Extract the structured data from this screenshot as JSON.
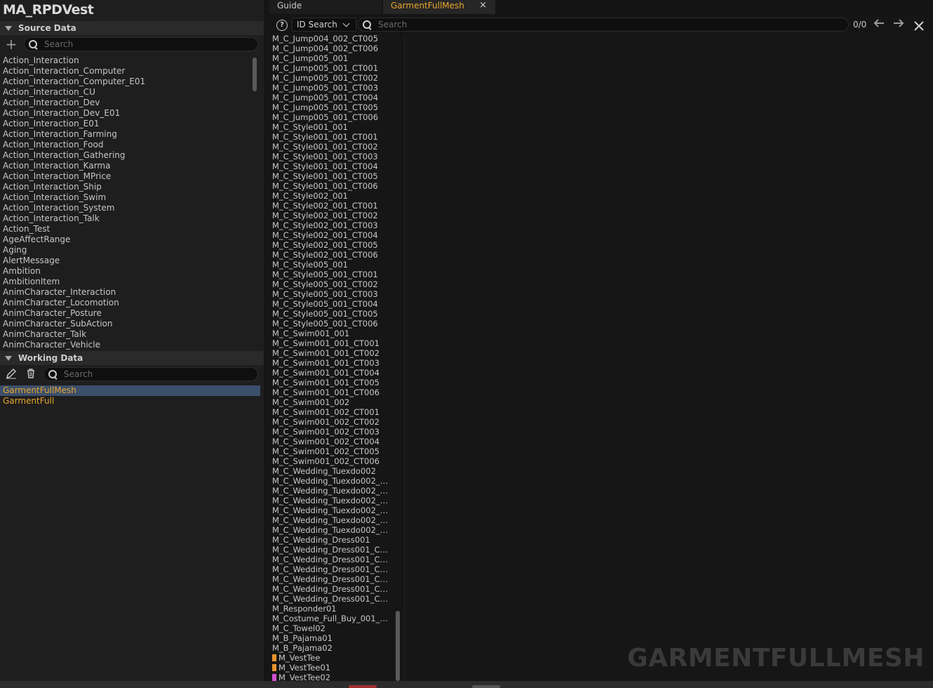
{
  "asset_title": "MA_RPDVest",
  "source": {
    "header": "Source Data",
    "search_placeholder": "Search",
    "items": [
      "Action_Interaction",
      "Action_Interaction_Computer",
      "Action_Interaction_Computer_E01",
      "Action_Interaction_CU",
      "Action_Interaction_Dev",
      "Action_Interaction_Dev_E01",
      "Action_Interaction_E01",
      "Action_Interaction_Farming",
      "Action_Interaction_Food",
      "Action_Interaction_Gathering",
      "Action_Interaction_Karma",
      "Action_Interaction_MPrice",
      "Action_Interaction_Ship",
      "Action_Interaction_Swim",
      "Action_Interaction_System",
      "Action_Interaction_Talk",
      "Action_Test",
      "AgeAffectRange",
      "Aging",
      "AlertMessage",
      "Ambition",
      "AmbitionItem",
      "AnimCharacter_Interaction",
      "AnimCharacter_Locomotion",
      "AnimCharacter_Posture",
      "AnimCharacter_SubAction",
      "AnimCharacter_Talk",
      "AnimCharacter_Vehicle"
    ]
  },
  "working": {
    "header": "Working Data",
    "search_placeholder": "Search",
    "items": [
      "GarmentFullMesh",
      "GarmentFull"
    ]
  },
  "tabs": {
    "guide": "Guide",
    "active": "GarmentFullMesh",
    "close_glyph": "×"
  },
  "search_bar": {
    "help_glyph": "?",
    "mode": "ID Search",
    "placeholder": "Search",
    "match_count": "0/0"
  },
  "id_list": [
    "M_C_Jump004_002_CT005",
    "M_C_Jump004_002_CT006",
    "M_C_Jump005_001",
    "M_C_Jump005_001_CT001",
    "M_C_Jump005_001_CT002",
    "M_C_Jump005_001_CT003",
    "M_C_Jump005_001_CT004",
    "M_C_Jump005_001_CT005",
    "M_C_Jump005_001_CT006",
    "M_C_Style001_001",
    "M_C_Style001_001_CT001",
    "M_C_Style001_001_CT002",
    "M_C_Style001_001_CT003",
    "M_C_Style001_001_CT004",
    "M_C_Style001_001_CT005",
    "M_C_Style001_001_CT006",
    "M_C_Style002_001",
    "M_C_Style002_001_CT001",
    "M_C_Style002_001_CT002",
    "M_C_Style002_001_CT003",
    "M_C_Style002_001_CT004",
    "M_C_Style002_001_CT005",
    "M_C_Style002_001_CT006",
    "M_C_Style005_001",
    "M_C_Style005_001_CT001",
    "M_C_Style005_001_CT002",
    "M_C_Style005_001_CT003",
    "M_C_Style005_001_CT004",
    "M_C_Style005_001_CT005",
    "M_C_Style005_001_CT006",
    "M_C_Swim001_001",
    "M_C_Swim001_001_CT001",
    "M_C_Swim001_001_CT002",
    "M_C_Swim001_001_CT003",
    "M_C_Swim001_001_CT004",
    "M_C_Swim001_001_CT005",
    "M_C_Swim001_001_CT006",
    "M_C_Swim001_002",
    "M_C_Swim001_002_CT001",
    "M_C_Swim001_002_CT002",
    "M_C_Swim001_002_CT003",
    "M_C_Swim001_002_CT004",
    "M_C_Swim001_002_CT005",
    "M_C_Swim001_002_CT006",
    "M_C_Wedding_Tuexdo002",
    "M_C_Wedding_Tuexdo002_CT…",
    "M_C_Wedding_Tuexdo002_CT…",
    "M_C_Wedding_Tuexdo002_CT…",
    "M_C_Wedding_Tuexdo002_CT…",
    "M_C_Wedding_Tuexdo002_CT…",
    "M_C_Wedding_Tuexdo002_CT…",
    "M_C_Wedding_Dress001",
    "M_C_Wedding_Dress001_CT0…",
    "M_C_Wedding_Dress001_CT0…",
    "M_C_Wedding_Dress001_CT0…",
    "M_C_Wedding_Dress001_CT0…",
    "M_C_Wedding_Dress001_CT0…",
    "M_C_Wedding_Dress001_CT0…",
    "M_Responder01",
    "M_Costume_Full_Buy_001_We…",
    "M_C_Towel02",
    "M_B_Pajama01",
    "M_B_Pajama02",
    "M_VestTee",
    "M_VestTee01",
    "M_VestTee02"
  ],
  "id_list_swatches": {
    "M_VestTee": "#e8952e",
    "M_VestTee01": "#e8952e",
    "M_VestTee02": "#d050d0"
  },
  "watermark": "GARMENTFULLMESH",
  "colors": {
    "accent_orange": "#e8a52e",
    "selection_blue": "#3b4f6b"
  }
}
